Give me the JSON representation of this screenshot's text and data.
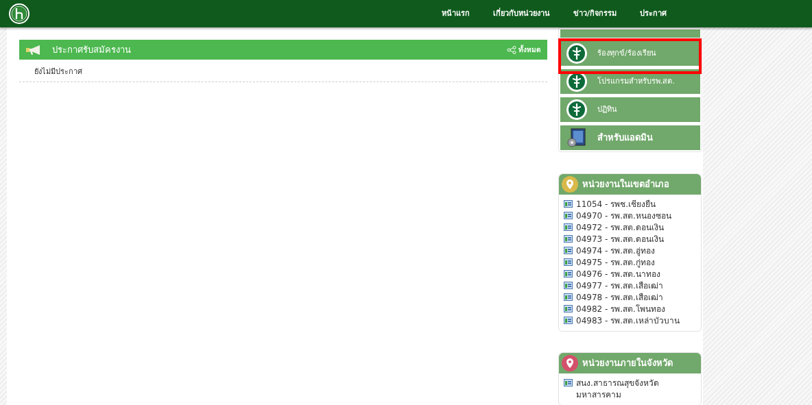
{
  "nav": [
    "หน้าแรก",
    "เกี่ยวกับหน่วยงาน",
    "ข่าว/กิจกรรม",
    "ประกาศ"
  ],
  "announcement": {
    "title": "ประกาศรับสมัครงาน",
    "all_link": "ทั้งหมด",
    "empty_text": "ยังไม่มีประกาศ"
  },
  "menu": [
    {
      "label": "ร้องทุกข์/ร้องเรียน",
      "kind": "emblem",
      "highlighted": true
    },
    {
      "label": "โปรแกรมสำหรับรพ.สต.",
      "kind": "emblem",
      "highlighted": false
    },
    {
      "label": "ปฏิทิน",
      "kind": "emblem",
      "highlighted": false
    },
    {
      "label": "สำหรับแอดมิน",
      "kind": "admin",
      "highlighted": false
    }
  ],
  "district_units": {
    "title": "หน่วยงานในเขตอำเภอ",
    "items": [
      "11054 - รพช.เชียงยืน",
      "04970 - รพ.สต.หนองซอน",
      "04972 - รพ.สต.ดอนเงิน",
      "04973 - รพ.สต.ดอนเงิน",
      "04974 - รพ.สต.อู่ทอง",
      "04975 - รพ.สต.กู่ทอง",
      "04976 - รพ.สต.นาทอง",
      "04977 - รพ.สต.เสือเฒ่า",
      "04978 - รพ.สต.เสือเฒ่า",
      "04982 - รพ.สต.โพนทอง",
      "04983 - รพ.สต.เหล่าบัวบาน"
    ]
  },
  "province_units": {
    "title": "หน่วยงานภายในจังหวัด",
    "items": [
      "สนง.สาธารณสุขจังหวัดมหาสารคาม"
    ]
  }
}
